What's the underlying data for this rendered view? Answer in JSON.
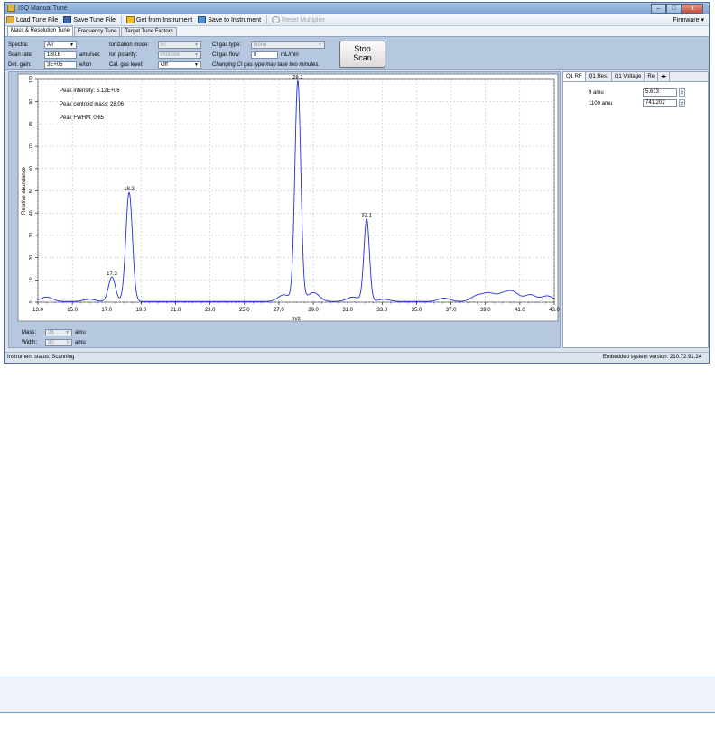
{
  "window": {
    "title": "ISQ Manual Tune"
  },
  "toolbar": {
    "load": "Load Tune File",
    "save": "Save Tune File",
    "get": "Get from Instrument",
    "put": "Save to Instrument",
    "reset": "Reset Multiplier",
    "firmware": "Firmware"
  },
  "tabs": [
    "Mass & Resolution Tune",
    "Frequency Tune",
    "Target Tune Factors"
  ],
  "controls": {
    "spectra_label": "Spectra:",
    "spectra_value": "Air",
    "scan_rate_label": "Scan rate:",
    "scan_rate_value": "180.6",
    "scan_rate_unit": "amu/sec",
    "det_gain_label": "Det. gain:",
    "det_gain_value": "3E+05",
    "det_gain_unit": "e/Ion",
    "ionization_label": "Ionization mode:",
    "ionization_value": "EI",
    "polarity_label": "Ion polarity:",
    "polarity_value": "Positive",
    "cal_gas_label": "Cal. gas level:",
    "cal_gas_value": "Off",
    "ci_type_label": "CI gas type:",
    "ci_type_value": "None",
    "ci_flow_label": "CI gas flow:",
    "ci_flow_value": "0",
    "ci_flow_unit": "mL/min",
    "ci_note": "Changing CI gas type may take two minutes.",
    "stop_line1": "Stop",
    "stop_line2": "Scan"
  },
  "peak_info": {
    "intensity": "Peak intensity: 5.12E+06",
    "centroid": "Peak centroid mass: 28.06",
    "fwhm": "Peak FWHM: 0.65"
  },
  "chart_data": {
    "type": "line",
    "xlabel": "m/z",
    "ylabel": "Relative abundance",
    "xlim": [
      13.0,
      43.0
    ],
    "ylim": [
      0,
      100
    ],
    "xticks": [
      13.0,
      15.0,
      17.0,
      19.0,
      21.0,
      23.0,
      25.0,
      27.0,
      29.0,
      31.0,
      33.0,
      35.0,
      37.0,
      39.0,
      41.0,
      43.0
    ],
    "xtick_labels": [
      "13.0",
      "15.0",
      "17.0",
      "19.0",
      "21.0",
      "23.0",
      "25.0",
      "27.0",
      "29.0",
      "31.0",
      "33.0",
      "35.0",
      "37.0",
      "39.0",
      "41.0",
      "43.0"
    ],
    "yticks": [
      0,
      10,
      20,
      30,
      40,
      50,
      60,
      70,
      80,
      90,
      100
    ],
    "ytick_labels": [
      "0",
      "10",
      "20",
      "30",
      "40",
      "50",
      "60",
      "70",
      "80",
      "90",
      "100"
    ],
    "grid": true,
    "peaks": [
      {
        "mz": 17.3,
        "height": 11,
        "width": 0.4,
        "label": "17.3"
      },
      {
        "mz": 18.3,
        "height": 49,
        "width": 0.38,
        "label": "18.3"
      },
      {
        "mz": 28.1,
        "height": 99,
        "width": 0.34,
        "label": "28.1"
      },
      {
        "mz": 32.1,
        "height": 37,
        "width": 0.32,
        "label": "32.1"
      }
    ],
    "ripples": [
      {
        "mz": 13.5,
        "height": 2
      },
      {
        "mz": 16.0,
        "height": 1
      },
      {
        "mz": 27.3,
        "height": 3
      },
      {
        "mz": 29.0,
        "height": 4
      },
      {
        "mz": 31.3,
        "height": 2
      },
      {
        "mz": 33.1,
        "height": 1
      },
      {
        "mz": 36.6,
        "height": 1.5
      },
      {
        "mz": 38.5,
        "height": 2.5
      },
      {
        "mz": 39.2,
        "height": 3.5
      },
      {
        "mz": 40.0,
        "height": 3
      },
      {
        "mz": 40.6,
        "height": 4
      },
      {
        "mz": 41.6,
        "height": 3
      },
      {
        "mz": 42.6,
        "height": 2.5
      }
    ]
  },
  "bottom": {
    "mass_label": "Mass:",
    "mass_value": "28",
    "mass_unit": "amu",
    "width_label": "Width:",
    "width_value": "30",
    "width_unit": "amu"
  },
  "right_panel": {
    "tabs": [
      "Q1 RF",
      "Q1 Res.",
      "Q1 Voltage",
      "Re"
    ],
    "rows": [
      {
        "label": "9 amu",
        "value": "5.613"
      },
      {
        "label": "1100 amu",
        "value": "741.202"
      }
    ]
  },
  "status": {
    "left": "Instrument status: Scanning",
    "right": "Embedded system version: 210.72.91.24"
  },
  "colors": {
    "trace": "#1f2fe0",
    "grid": "#b8b8b8",
    "panel": "#b6c8df"
  }
}
